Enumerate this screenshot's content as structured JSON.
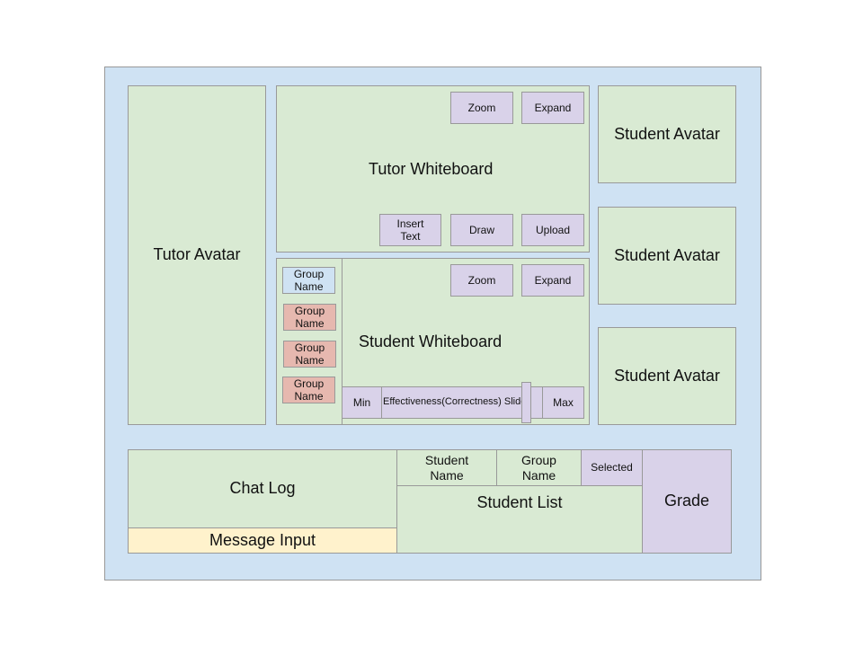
{
  "tutor_avatar": "Tutor Avatar",
  "tutor_whiteboard": {
    "title": "Tutor Whiteboard",
    "zoom": "Zoom",
    "expand": "Expand",
    "insert_text": "Insert Text",
    "draw": "Draw",
    "upload": "Upload"
  },
  "student_avatars": [
    "Student Avatar",
    "Student Avatar",
    "Student Avatar"
  ],
  "groups": [
    {
      "label": "Group Name",
      "state": "selected"
    },
    {
      "label": "Group Name",
      "state": "flagged"
    },
    {
      "label": "Group Name",
      "state": "flagged"
    },
    {
      "label": "Group Name",
      "state": "flagged"
    }
  ],
  "student_whiteboard": {
    "title": "Student Whiteboard",
    "zoom": "Zoom",
    "expand": "Expand",
    "slider": {
      "min": "Min",
      "label": "Effectiveness(Correctness) Slider",
      "max": "Max"
    }
  },
  "chat": {
    "log": "Chat Log",
    "input": "Message Input"
  },
  "student_list": {
    "title": "Student List",
    "columns": [
      "Student Name",
      "Group Name",
      "Selected"
    ]
  },
  "grade": "Grade",
  "colors": {
    "background": "#cfe2f3",
    "panel": "#d9ead3",
    "button": "#d9d2e9",
    "group_flagged": "#e6b8af",
    "group_selected": "#cfe2f3",
    "input": "#fff2cc"
  }
}
